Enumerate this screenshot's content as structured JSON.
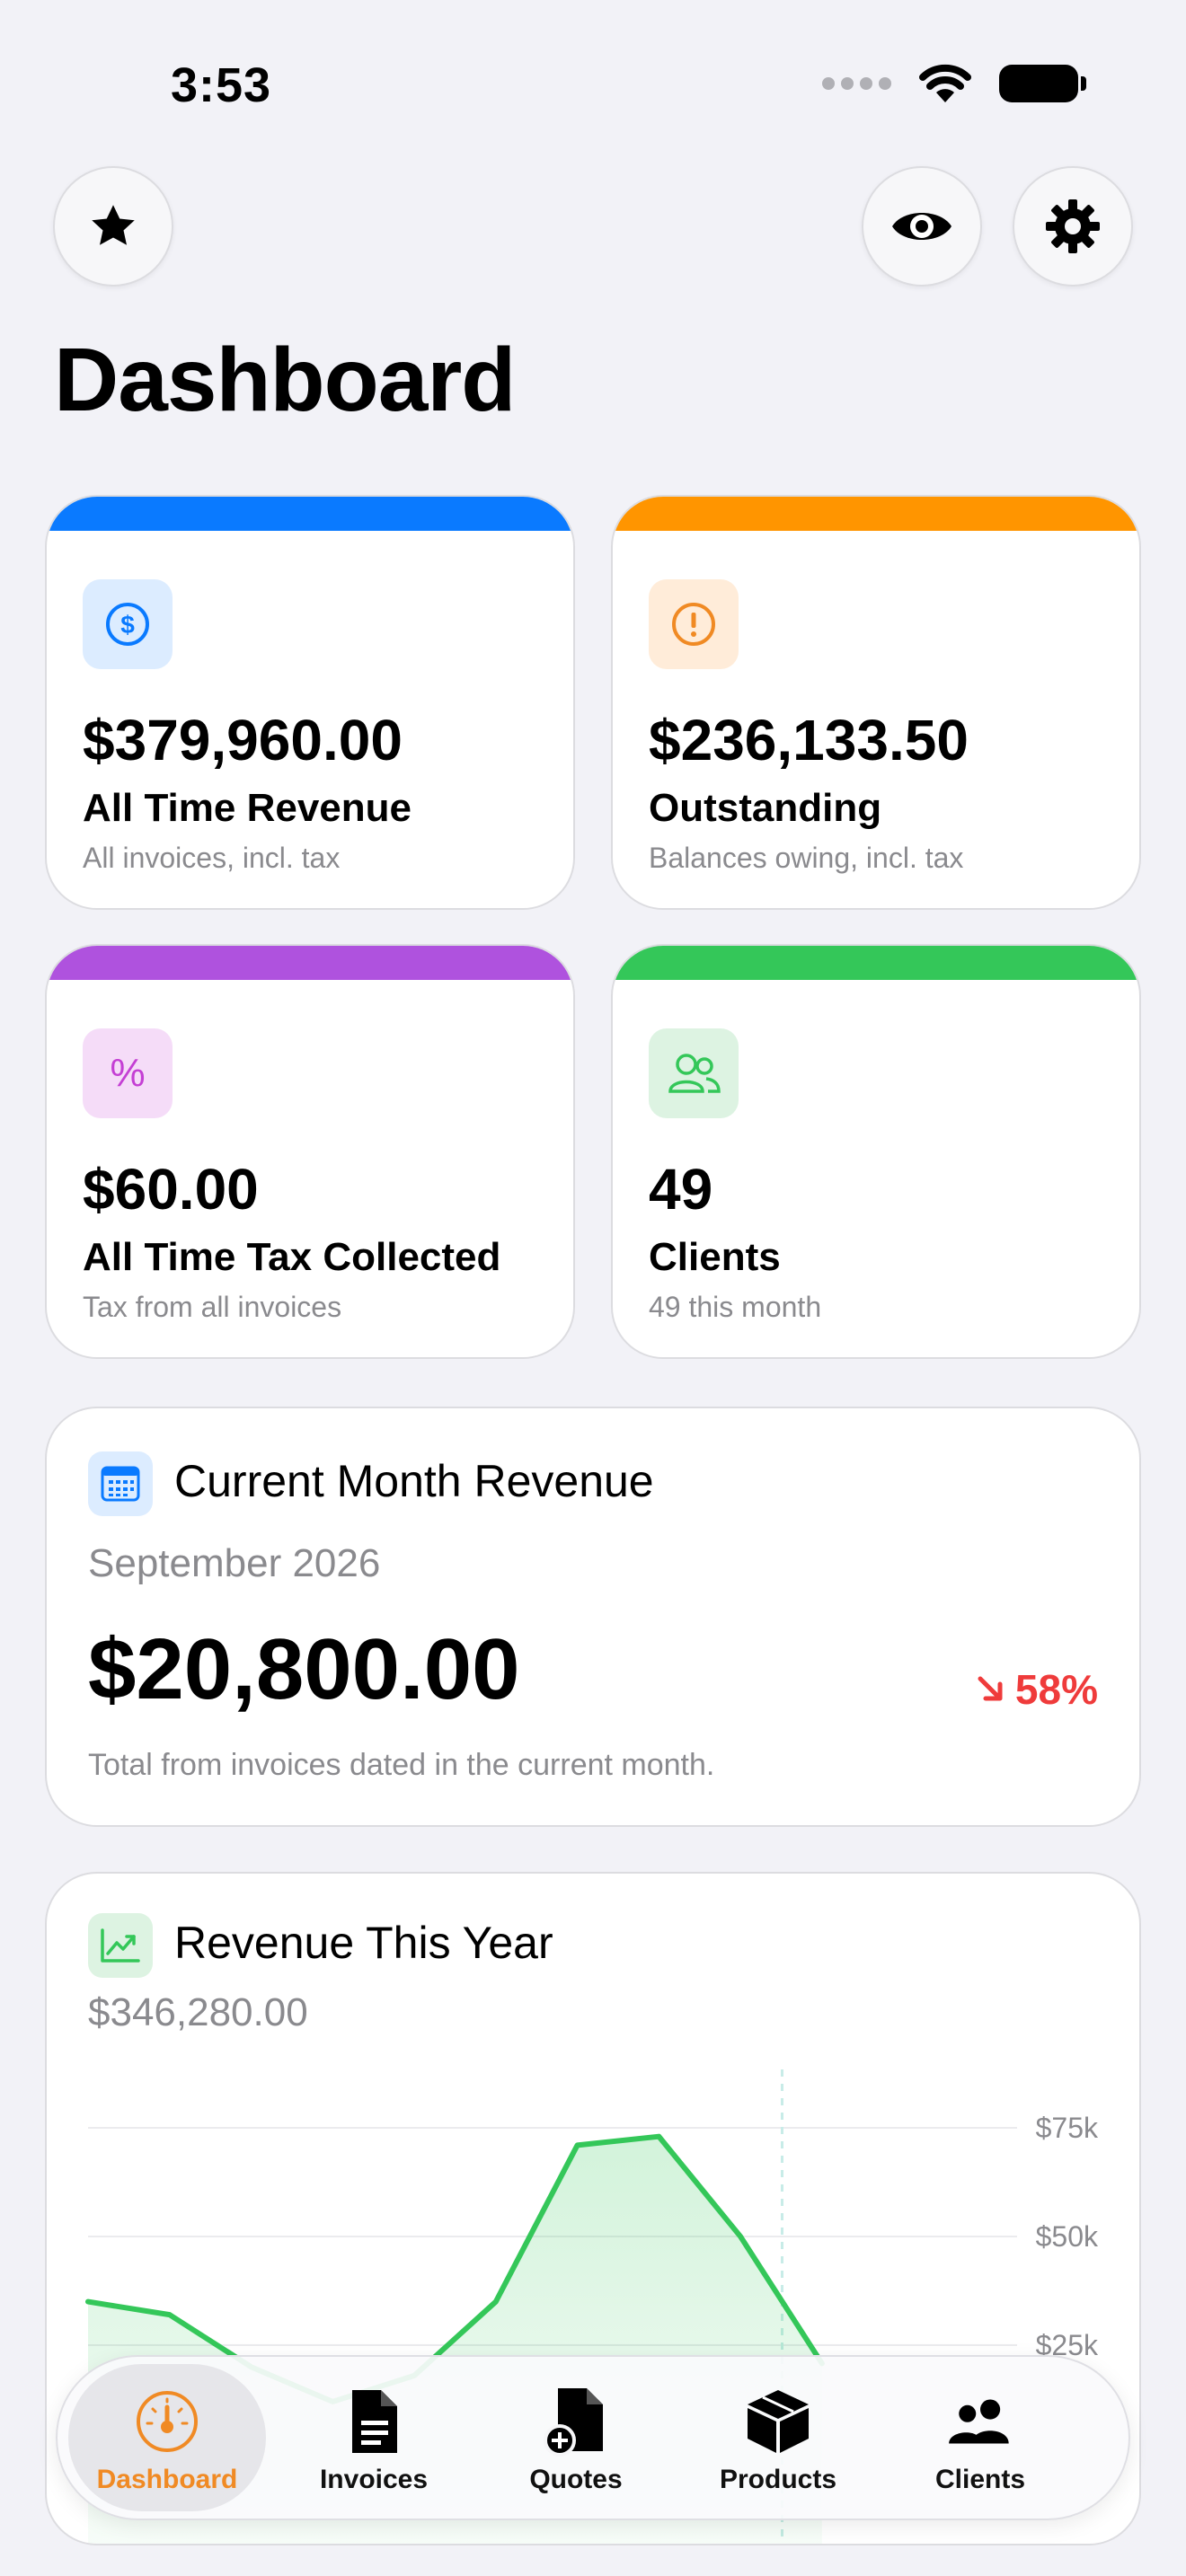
{
  "status": {
    "time": "3:53"
  },
  "header": {
    "title": "Dashboard"
  },
  "stats": [
    {
      "value": "$379,960.00",
      "label": "All Time Revenue",
      "sub": "All invoices, incl. tax",
      "color": "#0a7aff",
      "icon": "dollar-circle-icon"
    },
    {
      "value": "$236,133.50",
      "label": "Outstanding",
      "sub": "Balances owing, incl. tax",
      "color": "#ff9500",
      "icon": "exclamation-circle-icon"
    },
    {
      "value": "$60.00",
      "label": "All Time Tax Collected",
      "sub": "Tax from all invoices",
      "color": "#af52de",
      "icon": "percent-icon"
    },
    {
      "value": "49",
      "label": "Clients",
      "sub": "49 this month",
      "color": "#34c759",
      "icon": "people-icon"
    }
  ],
  "month_revenue": {
    "title": "Current Month Revenue",
    "period": "September 2026",
    "amount": "$20,800.00",
    "change": "58%",
    "change_direction": "down",
    "note": "Total from invoices dated in the current month."
  },
  "year_revenue": {
    "title": "Revenue This Year",
    "total": "$346,280.00"
  },
  "chart_data": {
    "type": "area",
    "y_ticks": [
      "$75k",
      "$50k",
      "$25k"
    ],
    "ylim": [
      0,
      80000
    ],
    "grid": true,
    "y_axis_position": "right",
    "series": [
      {
        "values": [
          35000,
          32000,
          20000,
          12000,
          18000,
          35000,
          71000,
          73000,
          50000,
          20800
        ]
      }
    ],
    "color": "#34c759"
  },
  "tabbar": {
    "tabs": [
      {
        "label": "Dashboard",
        "icon": "gauge-icon",
        "active": true
      },
      {
        "label": "Invoices",
        "icon": "document-icon",
        "active": false
      },
      {
        "label": "Quotes",
        "icon": "document-plus-icon",
        "active": false
      },
      {
        "label": "Products",
        "icon": "box-icon",
        "active": false
      },
      {
        "label": "Clients",
        "icon": "people-icon",
        "active": false
      }
    ],
    "active_color": "#f08a24"
  }
}
